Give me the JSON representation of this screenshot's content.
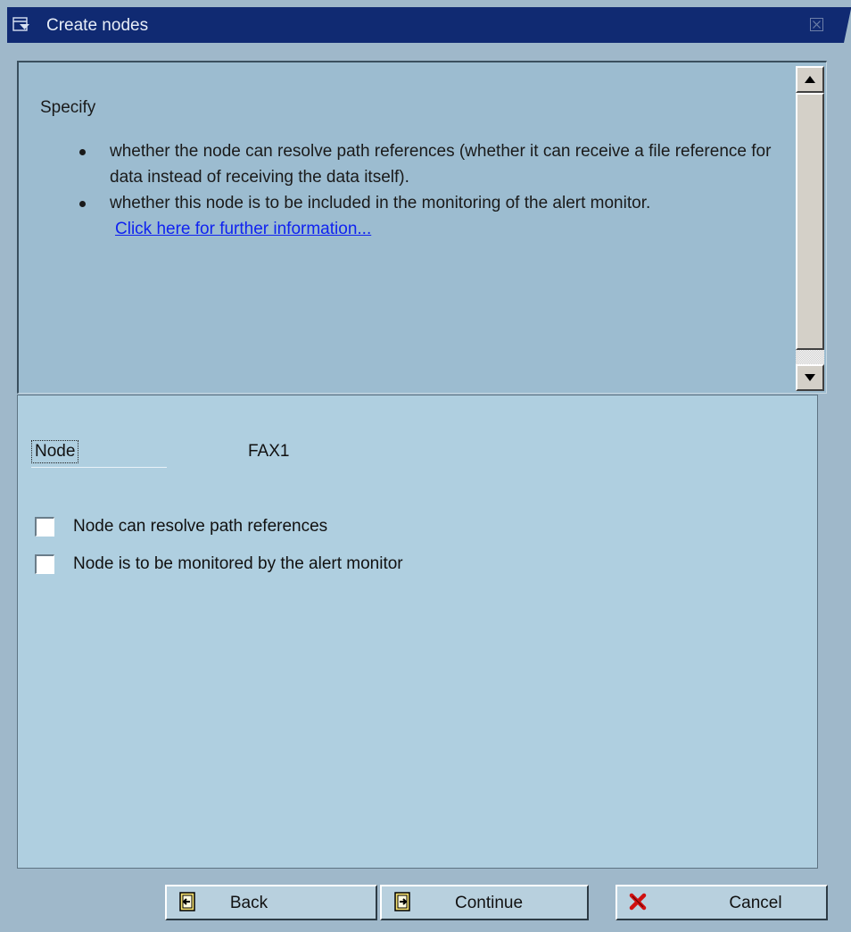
{
  "window": {
    "title": "Create nodes"
  },
  "info": {
    "intro": "Specify",
    "bullets": [
      "whether the node can resolve path references (whether it can receive a file reference for data instead of receiving the data itself).",
      "whether this node is to be included in the monitoring of the alert monitor."
    ],
    "link": "Click here for further information..."
  },
  "form": {
    "node_label": "Node",
    "node_value": "FAX1",
    "checkboxes": [
      {
        "label": "Node can resolve path references",
        "checked": false
      },
      {
        "label": "Node is to be monitored by the alert monitor",
        "checked": false
      }
    ]
  },
  "buttons": {
    "back": "Back",
    "continue": "Continue",
    "cancel": "Cancel"
  },
  "colors": {
    "titlebar": "#102a72",
    "info_panel": "#9cbcd0",
    "form_panel": "#afcfe0",
    "link": "#1023f0",
    "cancel_icon": "#d01010"
  },
  "icons": {
    "title": "window-menu-icon",
    "close": "close-icon",
    "back": "back-icon",
    "continue": "continue-icon",
    "cancel": "cancel-x-icon"
  }
}
